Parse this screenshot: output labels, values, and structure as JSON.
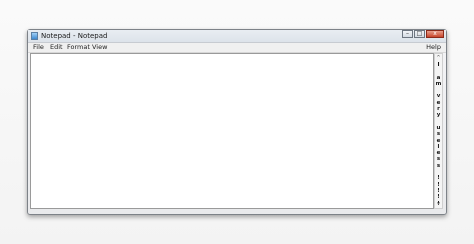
{
  "window": {
    "title": "Notepad - Notepad",
    "caption": {
      "minimize": "–",
      "maximize": "□",
      "close": "x"
    }
  },
  "menu": {
    "file": "File",
    "edit": "Edit",
    "format": "Format",
    "view": "View",
    "help": "Help"
  },
  "scrollbar": {
    "up_arrow": "^",
    "down_arrow": "v",
    "letters": [
      "I",
      " ",
      "a",
      "m",
      " ",
      "v",
      "e",
      "r",
      "y",
      " ",
      "u",
      "s",
      "e",
      "l",
      "e",
      "s",
      "s",
      " ",
      "!",
      "!",
      "!",
      "!",
      "!"
    ]
  }
}
